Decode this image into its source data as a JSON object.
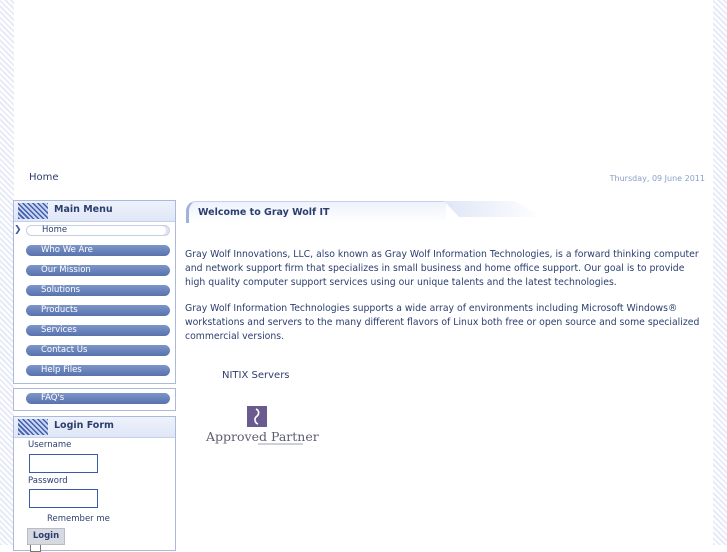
{
  "breadcrumb": {
    "home": "Home"
  },
  "date": "Thursday, 09 June 2011",
  "main_menu": {
    "title": "Main Menu",
    "items": [
      {
        "label": "Home",
        "active": true
      },
      {
        "label": "Who We Are"
      },
      {
        "label": "Our Mission"
      },
      {
        "label": "Solutions"
      },
      {
        "label": "Products"
      },
      {
        "label": "Services"
      },
      {
        "label": "Contact Us"
      },
      {
        "label": "Help Files"
      }
    ]
  },
  "faq_menu": {
    "item": "FAQ's"
  },
  "login": {
    "title": "Login Form",
    "username_label": "Username",
    "password_label": "Password",
    "remember_label": "Remember me",
    "button": "Login"
  },
  "article": {
    "tab_title": "Welcome to Gray Wolf IT",
    "p1": "Gray Wolf Innovations, LLC, also known as Gray Wolf Information Technologies, is a forward thinking computer and network support firm that specializes in small business and home office support. Our goal is to provide high quality computer support services using our unique talents and the latest technologies.",
    "p2": " Gray Wolf Information Technologies supports a wide array of environments including Microsoft Windows® workstations and servers to the many different flavors of Linux both free or open source and some specialized commercial versions.",
    "nitix": "NITIX Servers",
    "partner": "Approved Partner"
  },
  "colors": {
    "text": "#2b3e6e",
    "menu": "#5872ad",
    "border": "#aab9dc"
  }
}
